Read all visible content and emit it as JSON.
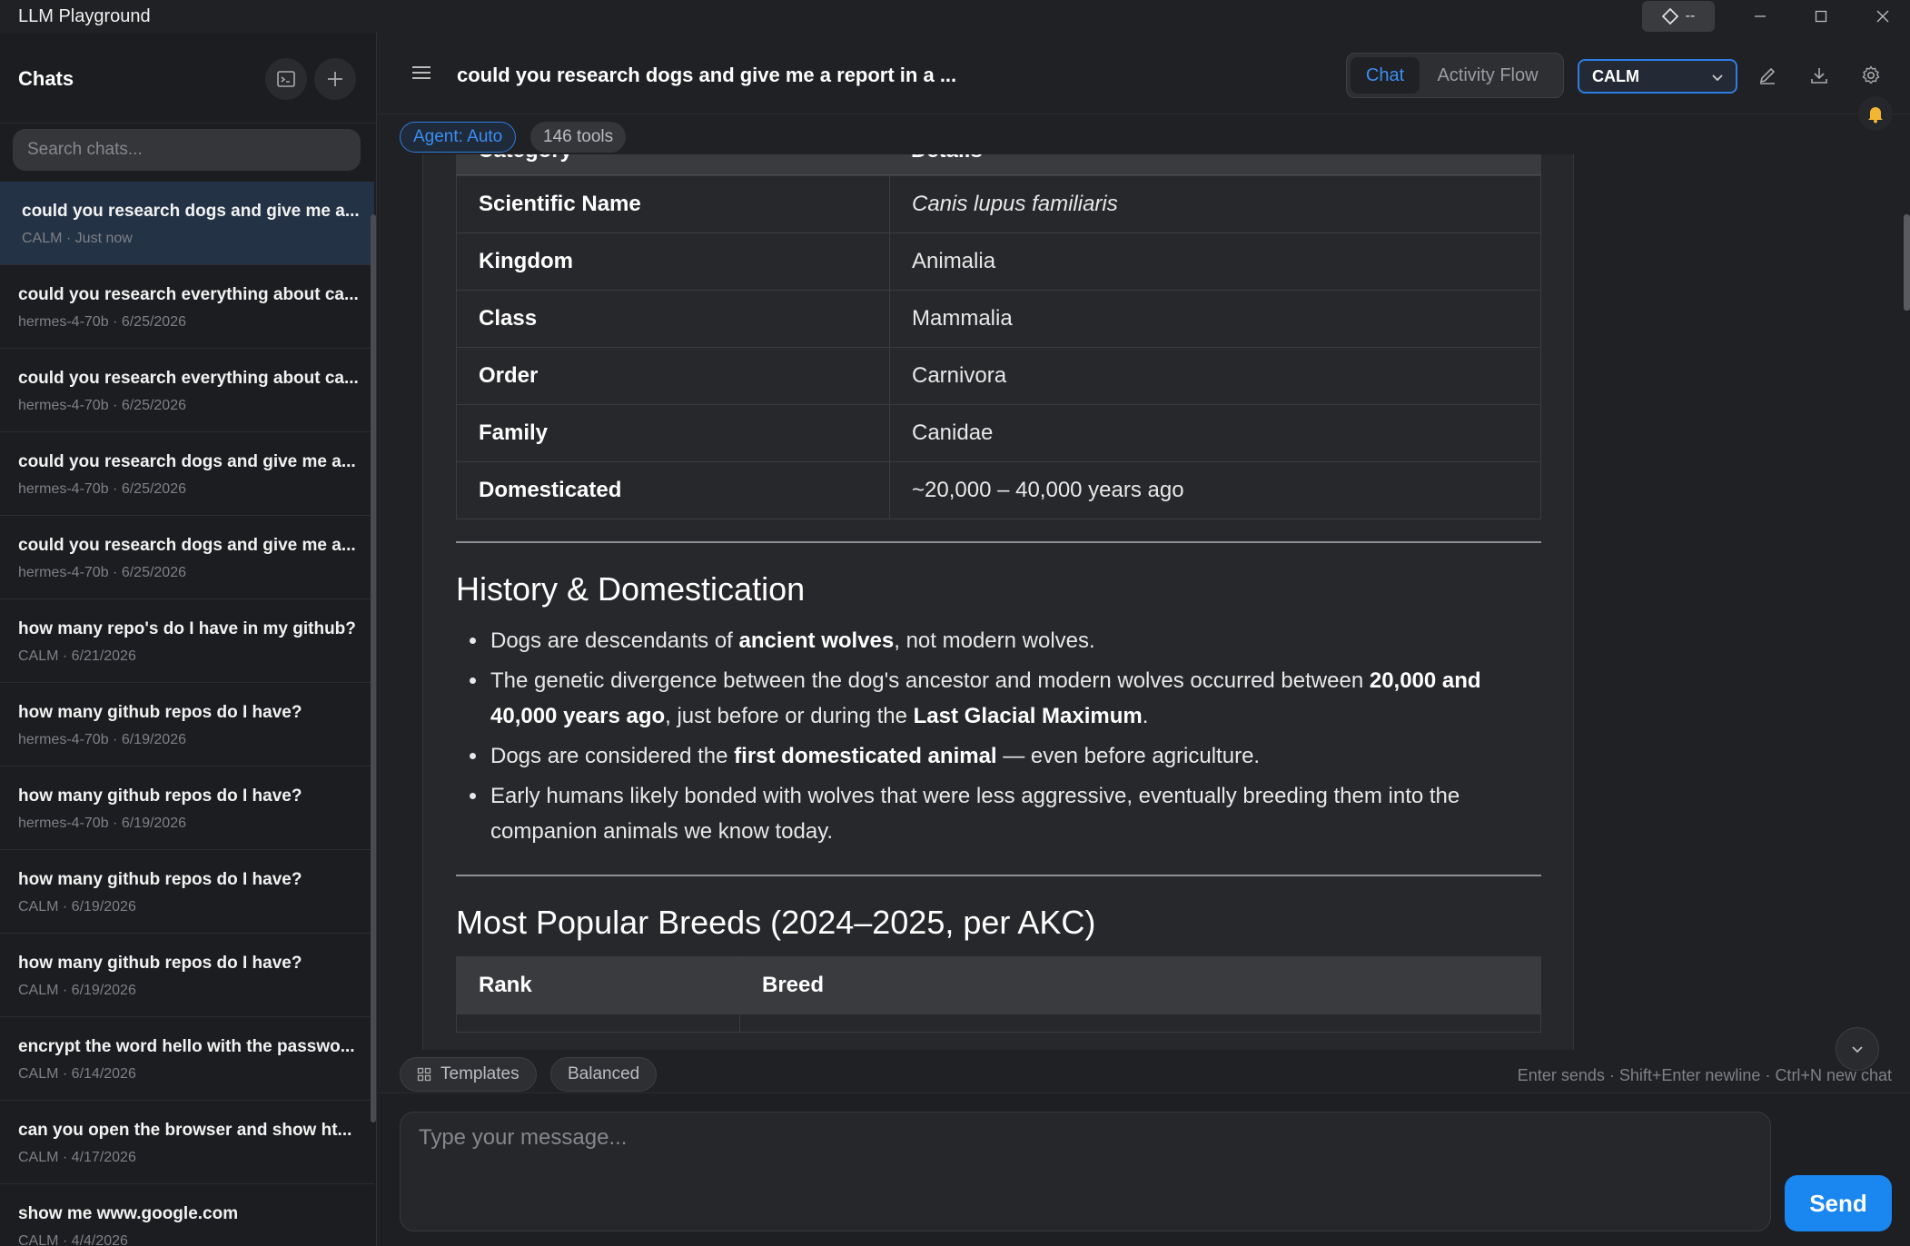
{
  "app": {
    "title": "LLM Playground",
    "ext_label": "--"
  },
  "sidebar": {
    "title": "Chats",
    "search_placeholder": "Search chats...",
    "chats": [
      {
        "title": "could you research dogs and give me a...",
        "meta": "CALM · Just now"
      },
      {
        "title": "could you research everything about ca...",
        "meta": "hermes-4-70b · 6/25/2026"
      },
      {
        "title": "could you research everything about ca...",
        "meta": "hermes-4-70b · 6/25/2026"
      },
      {
        "title": "could you research dogs and give me a...",
        "meta": "hermes-4-70b · 6/25/2026"
      },
      {
        "title": "could you research dogs and give me a...",
        "meta": "hermes-4-70b · 6/25/2026"
      },
      {
        "title": "how many repo's do I have in my github?",
        "meta": "CALM · 6/21/2026"
      },
      {
        "title": "how many github repos do I have?",
        "meta": "hermes-4-70b · 6/19/2026"
      },
      {
        "title": "how many github repos do I have?",
        "meta": "hermes-4-70b · 6/19/2026"
      },
      {
        "title": "how many github repos do I have?",
        "meta": "CALM · 6/19/2026"
      },
      {
        "title": "how many github repos do I have?",
        "meta": "CALM · 6/19/2026"
      },
      {
        "title": "encrypt the word hello with the passwo...",
        "meta": "CALM · 6/14/2026"
      },
      {
        "title": "can you open the browser and show ht...",
        "meta": "CALM · 4/17/2026"
      },
      {
        "title": "show me www.google.com",
        "meta": "CALM · 4/4/2026"
      }
    ]
  },
  "header": {
    "chat_title": "could you research dogs and give me a report in a ...",
    "tab_chat": "Chat",
    "tab_activity": "Activity Flow",
    "model": "CALM"
  },
  "chips": {
    "agent": "Agent: Auto",
    "tools": "146 tools"
  },
  "report": {
    "table_head": {
      "col1": "Category",
      "col2": "Details"
    },
    "classification": [
      {
        "key": "Scientific Name",
        "value": "Canis lupus familiaris"
      },
      {
        "key": "Kingdom",
        "value": "Animalia"
      },
      {
        "key": "Class",
        "value": "Mammalia"
      },
      {
        "key": "Order",
        "value": "Carnivora"
      },
      {
        "key": "Family",
        "value": "Canidae"
      },
      {
        "key": "Domesticated",
        "value": "~20,000 – 40,000 years ago"
      }
    ],
    "history_heading": "History & Domestication",
    "history": {
      "b1": {
        "pre": "Dogs are descendants of ",
        "bold": "ancient wolves",
        "post": ", not modern wolves."
      },
      "b2": {
        "pre": "The genetic divergence between the dog's ancestor and modern wolves occurred between ",
        "bold1": "20,000 and 40,000 years ago",
        "mid": ", just before or during the ",
        "bold2": "Last Glacial Maximum",
        "post": "."
      },
      "b3": {
        "pre": "Dogs are considered the ",
        "bold": "first domesticated animal",
        "post": " — even before agriculture."
      },
      "b4": {
        "text": "Early humans likely bonded with wolves that were less aggressive, eventually breeding them into the companion animals we know today."
      }
    },
    "breeds_heading": "Most Popular Breeds (2024–2025, per AKC)",
    "breeds_head": {
      "col1": "Rank",
      "col2": "Breed"
    }
  },
  "composer": {
    "templates": "Templates",
    "balanced": "Balanced",
    "hint": "Enter sends · Shift+Enter newline · Ctrl+N new chat",
    "placeholder": "Type your message...",
    "send": "Send"
  }
}
